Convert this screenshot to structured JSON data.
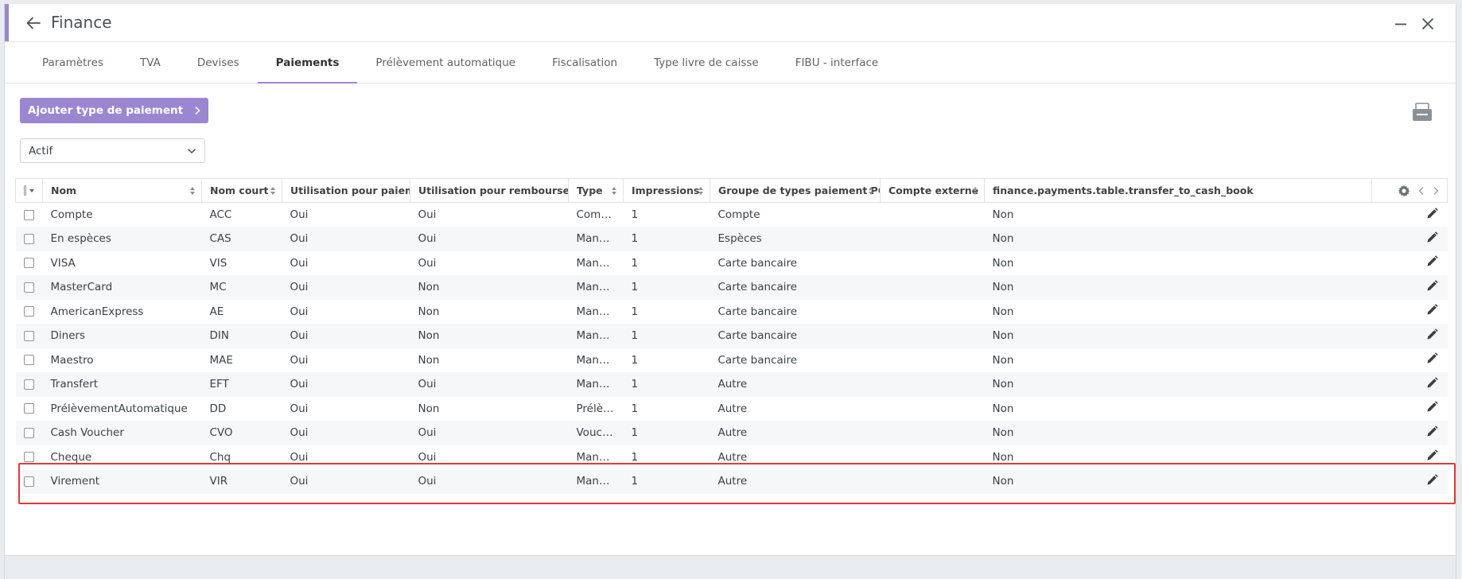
{
  "window": {
    "title": "Finance"
  },
  "tabs": [
    {
      "label": "Paramètres",
      "active": false
    },
    {
      "label": "TVA",
      "active": false
    },
    {
      "label": "Devises",
      "active": false
    },
    {
      "label": "Paiements",
      "active": true
    },
    {
      "label": "Prélèvement automatique",
      "active": false
    },
    {
      "label": "Fiscalisation",
      "active": false
    },
    {
      "label": "Type livre de caisse",
      "active": false
    },
    {
      "label": "FIBU - interface",
      "active": false
    }
  ],
  "toolbar": {
    "add_label": "Ajouter type de paiement",
    "filter_value": "Actif"
  },
  "table": {
    "columns": [
      "Nom",
      "Nom court",
      "Utilisation pour paiement",
      "Utilisation pour remboursement",
      "Type",
      "Impressions",
      "Groupe de types paiement POS",
      "Compte externe",
      "finance.payments.table.transfer_to_cash_book"
    ],
    "rows": [
      [
        "Compte",
        "ACC",
        "Oui",
        "Oui",
        "Compte",
        "1",
        "Compte",
        "",
        "Non"
      ],
      [
        "En espèces",
        "CAS",
        "Oui",
        "Oui",
        "Manuel",
        "1",
        "Espèces",
        "",
        "Non"
      ],
      [
        "VISA",
        "VIS",
        "Oui",
        "Oui",
        "Manuel",
        "1",
        "Carte bancaire",
        "",
        "Non"
      ],
      [
        "MasterCard",
        "MC",
        "Oui",
        "Non",
        "Manuel",
        "1",
        "Carte bancaire",
        "",
        "Non"
      ],
      [
        "AmericanExpress",
        "AE",
        "Oui",
        "Non",
        "Manuel",
        "1",
        "Carte bancaire",
        "",
        "Non"
      ],
      [
        "Diners",
        "DIN",
        "Oui",
        "Non",
        "Manuel",
        "1",
        "Carte bancaire",
        "",
        "Non"
      ],
      [
        "Maestro",
        "MAE",
        "Oui",
        "Non",
        "Manuel",
        "1",
        "Carte bancaire",
        "",
        "Non"
      ],
      [
        "Transfert",
        "EFT",
        "Oui",
        "Oui",
        "Manuel",
        "1",
        "Autre",
        "",
        "Non"
      ],
      [
        "PrélèvementAutomatique",
        "DD",
        "Oui",
        "Non",
        "Prélèv...",
        "1",
        "Autre",
        "",
        "Non"
      ],
      [
        "Cash Voucher",
        "CVO",
        "Oui",
        "Oui",
        "Voucher",
        "1",
        "Autre",
        "",
        "Non"
      ],
      [
        "Cheque",
        "Chq",
        "Oui",
        "Oui",
        "Manuel",
        "1",
        "Autre",
        "",
        "Non"
      ],
      [
        "Virement",
        "VIR",
        "Oui",
        "Oui",
        "Manuel",
        "1",
        "Autre",
        "",
        "Non"
      ]
    ]
  },
  "colors": {
    "accent": "#9b87d1",
    "highlight": "#e03a3a"
  },
  "icons": [
    "back-arrow-icon",
    "minimize-icon",
    "close-icon",
    "chevron-right-icon",
    "print-icon",
    "chevron-down-icon",
    "gear-icon",
    "chevron-left-icon",
    "pencil-icon"
  ]
}
